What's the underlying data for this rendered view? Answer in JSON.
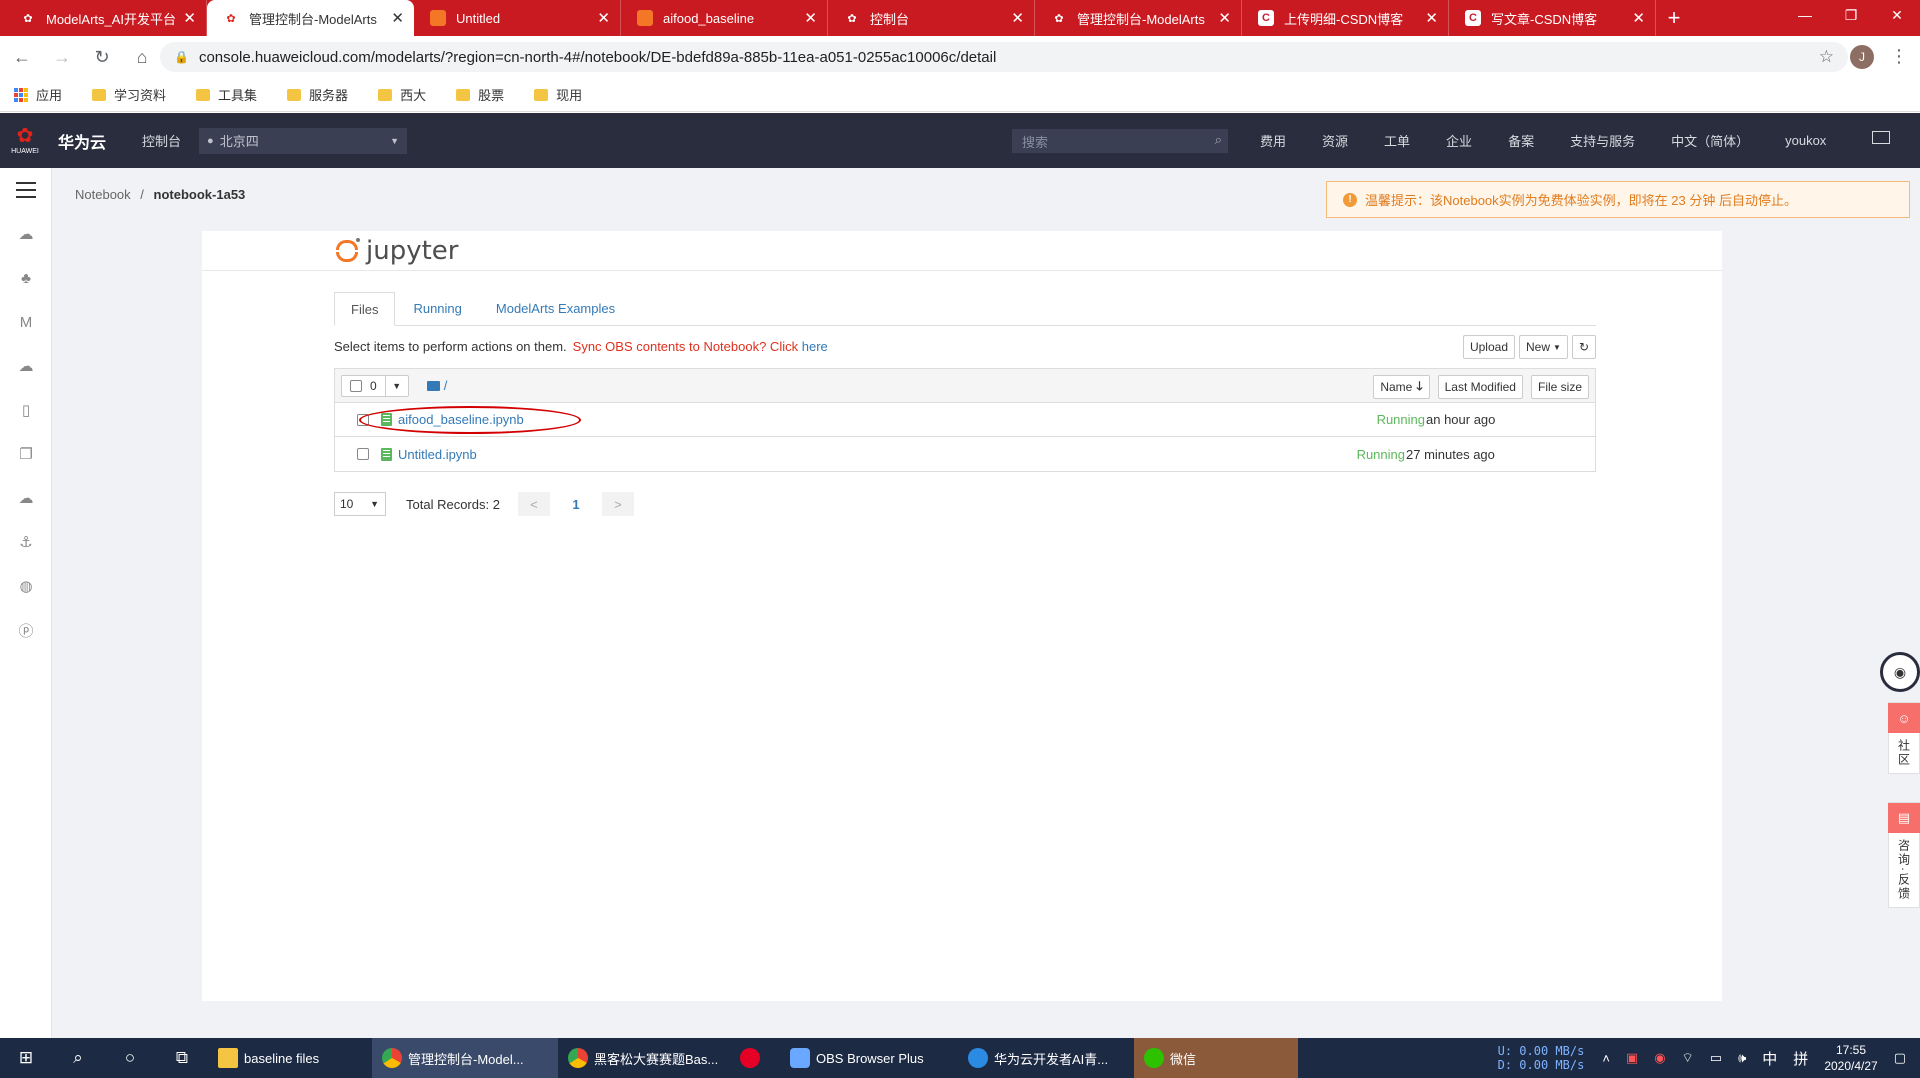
{
  "browser": {
    "tabs": [
      {
        "title": "ModelArts_AI开发平台",
        "icon": "huawei-icon",
        "active": false
      },
      {
        "title": "管理控制台-ModelArts",
        "icon": "huawei-icon",
        "active": true
      },
      {
        "title": "Untitled",
        "icon": "jupyter-icon",
        "active": false
      },
      {
        "title": "aifood_baseline",
        "icon": "jupyter-icon",
        "active": false
      },
      {
        "title": "控制台",
        "icon": "huawei-icon",
        "active": false
      },
      {
        "title": "管理控制台-ModelArts",
        "icon": "huawei-icon",
        "active": false
      },
      {
        "title": "上传明细-CSDN博客",
        "icon": "csdn-icon",
        "active": false
      },
      {
        "title": "写文章-CSDN博客",
        "icon": "csdn-icon",
        "active": false
      }
    ],
    "url": "console.huaweicloud.com/modelarts/?region=cn-north-4#/notebook/DE-bdefd89a-885b-11ea-a051-0255ac10006c/detail",
    "avatar_letter": "J",
    "bookmarks": [
      "应用",
      "学习资料",
      "工具集",
      "服务器",
      "西大",
      "股票",
      "现用"
    ]
  },
  "hwcloud": {
    "brand": "华为云",
    "logo_text": "HUAWEI",
    "console": "控制台",
    "region": "北京四",
    "search_placeholder": "搜索",
    "nav": [
      "费用",
      "资源",
      "工单",
      "企业",
      "备案",
      "支持与服务",
      "中文（简体）",
      "youkox"
    ]
  },
  "page": {
    "breadcrumb_parent": "Notebook",
    "breadcrumb_sep": "/",
    "breadcrumb_current": "notebook-1a53",
    "alert": "温馨提示：该Notebook实例为免费体验实例，即将在 23 分钟 后自动停止。"
  },
  "jupyter": {
    "logo_text": "jupyter",
    "tabs": [
      "Files",
      "Running",
      "ModelArts Examples"
    ],
    "select_msg": "Select items to perform actions on them.",
    "sync_msg": "Sync OBS contents to Notebook? Click",
    "sync_link": "here",
    "upload": "Upload",
    "new": "New",
    "selected_count": "0",
    "path": "/",
    "col_name": "Name",
    "col_modified": "Last Modified",
    "col_size": "File size",
    "files": [
      {
        "name": "aifood_baseline.ipynb",
        "status": "Running",
        "modified": "an hour ago"
      },
      {
        "name": "Untitled.ipynb",
        "status": "Running",
        "modified": "27 minutes ago"
      }
    ],
    "page_size": "10",
    "total_records": "Total Records: 2",
    "prev": "<",
    "page_num": "1",
    "next": ">"
  },
  "floats": {
    "community": "社区",
    "feedback": "咨询·反馈"
  },
  "taskbar": {
    "apps": [
      {
        "label": "baseline files",
        "active": false
      },
      {
        "label": "管理控制台-Model...",
        "active": true
      },
      {
        "label": "黑客松大赛赛题Bas...",
        "active": false
      },
      {
        "label": "",
        "active": false
      },
      {
        "label": "OBS Browser Plus",
        "active": false
      },
      {
        "label": "华为云开发者AI青...",
        "active": false
      },
      {
        "label": "微信",
        "active": false
      }
    ],
    "upload_speed": "U:   0.00 MB/s",
    "download_speed": "D:   0.00 MB/s",
    "ime": "中",
    "ime2": "拼",
    "time": "17:55",
    "date": "2020/4/27"
  },
  "colors": {
    "tabstrip": "#ca1a21",
    "hw_header": "#292d3e",
    "running": "#5cb85c",
    "link": "#337ab7",
    "alert": "#e07c1e"
  }
}
